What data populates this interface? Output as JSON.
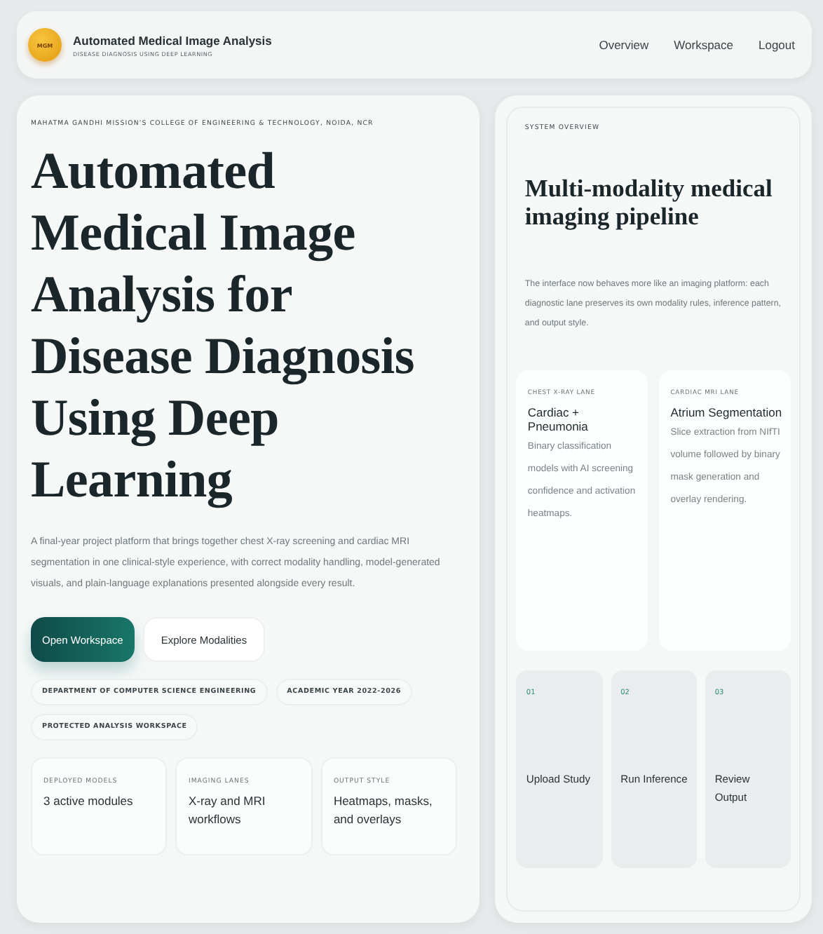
{
  "header": {
    "logo": "MGM",
    "title": "Automated Medical Image Analysis",
    "subtitle": "DISEASE DIAGNOSIS USING DEEP LEARNING",
    "nav": [
      {
        "label": "Overview"
      },
      {
        "label": "Workspace"
      },
      {
        "label": "Logout"
      }
    ]
  },
  "hero": {
    "eyebrow": "MAHATMA GANDHI MISSION'S COLLEGE OF ENGINEERING & TECHNOLOGY, NOIDA, NCR",
    "title": "Automated Medical Image Analysis for Disease Diagnosis Using Deep Learning",
    "description": "A final-year project platform that brings together chest X-ray screening and cardiac MRI segmentation in one clinical-style experience, with correct modality handling, model-generated visuals, and plain-language explanations presented alongside every result.",
    "buttons": [
      {
        "label": "Open Workspace",
        "kind": "primary"
      },
      {
        "label": "Explore Modalities",
        "kind": "secondary"
      }
    ],
    "tags": [
      "DEPARTMENT OF COMPUTER SCIENCE ENGINEERING",
      "ACADEMIC YEAR 2022-2026",
      "PROTECTED ANALYSIS WORKSPACE"
    ],
    "stats": [
      {
        "label": "DEPLOYED MODELS",
        "value": "3 active modules"
      },
      {
        "label": "IMAGING LANES",
        "value": "X-ray and MRI workflows"
      },
      {
        "label": "OUTPUT STYLE",
        "value": "Heatmaps, masks, and overlays"
      }
    ]
  },
  "overview": {
    "eyebrow": "SYSTEM OVERVIEW",
    "title": "Multi-modality medical imaging pipeline",
    "description": "The interface now behaves more like an imaging platform: each diagnostic lane preserves its own modality rules, inference pattern, and output style.",
    "lanes": [
      {
        "label": "CHEST X-RAY LANE",
        "title": "Cardiac + Pneumonia",
        "description": "Binary classification models with AI screening confidence and activation heatmaps."
      },
      {
        "label": "CARDIAC MRI LANE",
        "title": "Atrium Segmentation",
        "description": "Slice extraction from NIfTI volume followed by binary mask generation and overlay rendering."
      }
    ],
    "steps": [
      {
        "number": "01",
        "label": "Upload Study"
      },
      {
        "number": "02",
        "label": "Run Inference"
      },
      {
        "number": "03",
        "label": "Review Output"
      }
    ]
  }
}
